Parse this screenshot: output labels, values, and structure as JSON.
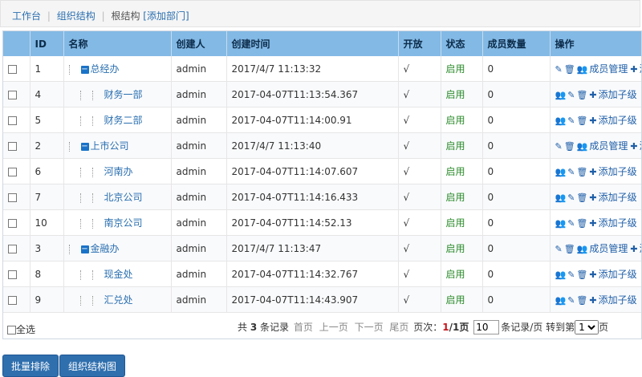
{
  "breadcrumb": {
    "items": [
      "工作台",
      "组织结构"
    ],
    "current": "根结构",
    "action": "[添加部门]"
  },
  "table": {
    "columns": [
      "ID",
      "名称",
      "创建人",
      "创建时间",
      "开放",
      "状态",
      "成员数量",
      "操作"
    ],
    "rows": [
      {
        "id": "1",
        "name": "总经办",
        "level": 0,
        "creator": "admin",
        "created": "2017/4/7 11:13:32",
        "open": "√",
        "status": "启用",
        "members": "0"
      },
      {
        "id": "4",
        "name": "财务一部",
        "level": 1,
        "creator": "admin",
        "created": "2017-04-07T11:13:54.367",
        "open": "√",
        "status": "启用",
        "members": "0"
      },
      {
        "id": "5",
        "name": "财务二部",
        "level": 1,
        "creator": "admin",
        "created": "2017-04-07T11:14:00.91",
        "open": "√",
        "status": "启用",
        "members": "0"
      },
      {
        "id": "2",
        "name": "上市公司",
        "level": 0,
        "creator": "admin",
        "created": "2017/4/7 11:13:40",
        "open": "√",
        "status": "启用",
        "members": "0"
      },
      {
        "id": "6",
        "name": "河南办",
        "level": 1,
        "creator": "admin",
        "created": "2017-04-07T11:14:07.607",
        "open": "√",
        "status": "启用",
        "members": "0"
      },
      {
        "id": "7",
        "name": "北京公司",
        "level": 1,
        "creator": "admin",
        "created": "2017-04-07T11:14:16.433",
        "open": "√",
        "status": "启用",
        "members": "0"
      },
      {
        "id": "10",
        "name": "南京公司",
        "level": 1,
        "creator": "admin",
        "created": "2017-04-07T11:14:52.13",
        "open": "√",
        "status": "启用",
        "members": "0"
      },
      {
        "id": "3",
        "name": "金融办",
        "level": 0,
        "creator": "admin",
        "created": "2017/4/7 11:13:47",
        "open": "√",
        "status": "启用",
        "members": "0"
      },
      {
        "id": "8",
        "name": "现金处",
        "level": 1,
        "creator": "admin",
        "created": "2017-04-07T11:14:32.767",
        "open": "√",
        "status": "启用",
        "members": "0"
      },
      {
        "id": "9",
        "name": "汇兑处",
        "level": 1,
        "creator": "admin",
        "created": "2017-04-07T11:14:43.907",
        "open": "√",
        "status": "启用",
        "members": "0"
      }
    ],
    "actions": {
      "member_manage": "成员管理",
      "add": "添加",
      "add_child": "添加子级"
    }
  },
  "footer": {
    "select_all": "全选",
    "total_prefix": "共",
    "total_count": "3",
    "total_suffix": "条记录",
    "first": "首页",
    "prev": "上一页",
    "next": "下一页",
    "last": "尾页",
    "page_label": "页次：",
    "page_current": "1",
    "page_total": "/1页",
    "per_page_value": "10",
    "per_page_suffix": "条记录/页",
    "goto_prefix": "转到第",
    "goto_value": "1",
    "goto_suffix": "页"
  },
  "buttons": {
    "batch_delete": "批量排除",
    "org_chart": "组织结构图"
  },
  "colors": {
    "header_bg": "#83b9e5",
    "link": "#2a6fb0",
    "button_bg": "#2f6fae",
    "status_green": "#2c8c2c"
  }
}
